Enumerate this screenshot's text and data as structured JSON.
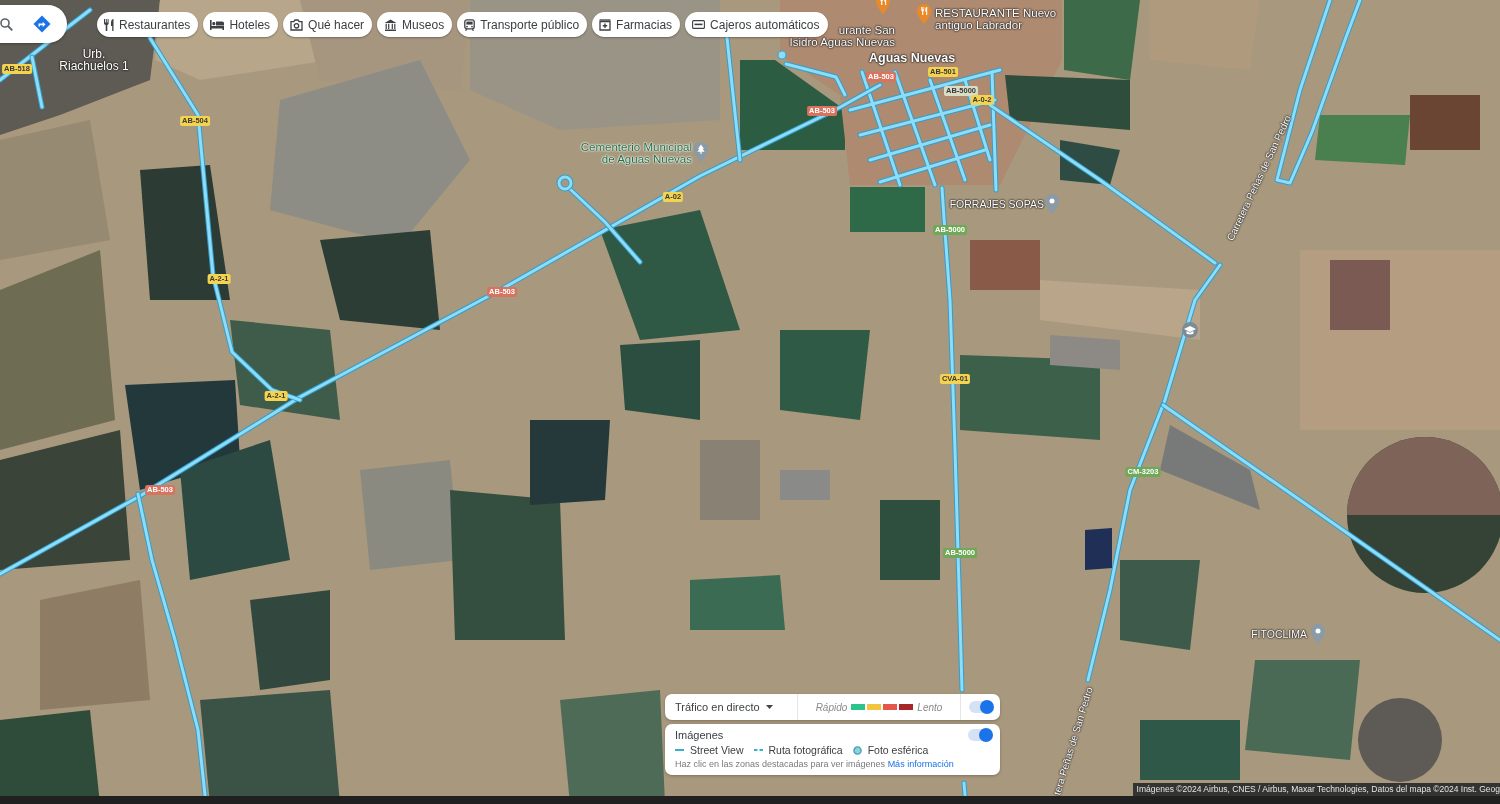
{
  "categories": [
    {
      "label": "Restaurantes"
    },
    {
      "label": "Hoteles"
    },
    {
      "label": "Qué hacer"
    },
    {
      "label": "Museos"
    },
    {
      "label": "Transporte público"
    },
    {
      "label": "Farmacias"
    },
    {
      "label": "Cajeros automáticos"
    }
  ],
  "map": {
    "places": [
      {
        "kind": "suburb",
        "lines": [
          "Urb.",
          "Riachuelos 1"
        ]
      },
      {
        "kind": "town",
        "lines": [
          "Aguas Nuevas"
        ]
      }
    ],
    "pois": [
      {
        "kind": "restaurant",
        "lines": [
          "urante San",
          "Isidro Aguas Nuevas"
        ]
      },
      {
        "kind": "restaurant",
        "lines": [
          "RESTAURANTE Nuevo",
          "antiguo Labrador"
        ]
      },
      {
        "kind": "cemetery",
        "lines": [
          "Cementerio Municipal",
          "de Aguas Nuevas"
        ]
      },
      {
        "kind": "business",
        "lines": [
          "FORRAJES SOPAS"
        ]
      },
      {
        "kind": "business",
        "lines": [
          "FITOCLIMA"
        ]
      }
    ],
    "road_names": [
      {
        "label": "Carretera Peñas de San Pedro"
      },
      {
        "label": "tera Peñas de San Pedro"
      }
    ],
    "road_signs": [
      {
        "label": "AB-518",
        "color": "#f3d34f"
      },
      {
        "label": "AB-501",
        "color": "#f3d34f"
      },
      {
        "label": "AB-503",
        "color": "#d8735f"
      },
      {
        "label": "AB-5000",
        "color": "#d9ddc5"
      },
      {
        "label": "A-0-2",
        "color": "#f3d34f"
      },
      {
        "label": "AB-503",
        "color": "#d8735f"
      },
      {
        "label": "AB-504",
        "color": "#f3d34f"
      },
      {
        "label": "A-02",
        "color": "#f3d34f"
      },
      {
        "label": "AB-5000",
        "color": "#6fa957"
      },
      {
        "label": "A-2-1",
        "color": "#f3d34f"
      },
      {
        "label": "AB-503",
        "color": "#d8735f"
      },
      {
        "label": "CVA-01",
        "color": "#f3d34f"
      },
      {
        "label": "A-2-1",
        "color": "#f3d34f"
      },
      {
        "label": "CM-3203",
        "color": "#6fa957"
      },
      {
        "label": "AB-503",
        "color": "#d8735f"
      },
      {
        "label": "AB-5000",
        "color": "#6fa957"
      }
    ]
  },
  "layers": {
    "traffic": {
      "label": "Tráfico en directo",
      "fast": "Rápido",
      "slow": "Lento",
      "scale": [
        {
          "color": "#2bc48a"
        },
        {
          "color": "#f4c33f"
        },
        {
          "color": "#e5564b"
        },
        {
          "color": "#a8252a"
        }
      ],
      "on": true
    },
    "imagery": {
      "label": "Imágenes",
      "on": true,
      "legend": [
        {
          "kind": "line",
          "label": "Street View"
        },
        {
          "kind": "dashed",
          "label": "Ruta fotográfica"
        },
        {
          "kind": "circle",
          "label": "Foto esférica"
        }
      ],
      "hint": "Haz clic en las zonas destacadas para ver imágenes",
      "link": "Más información"
    }
  },
  "attribution": "Imágenes ©2024 Airbus, CNES / Airbus, Maxar Technologies, Datos del mapa ©2024 Inst. Geog"
}
